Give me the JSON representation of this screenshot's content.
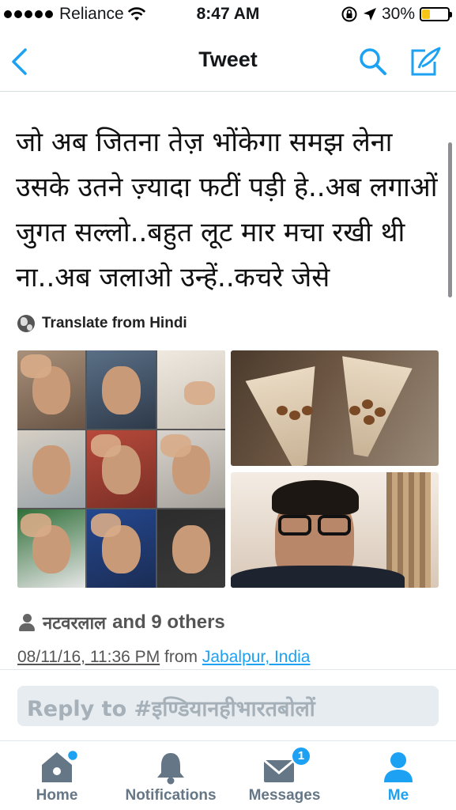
{
  "status_bar": {
    "carrier": "Reliance",
    "time": "8:47 AM",
    "battery_percent": "30%",
    "battery_level": 0.3,
    "battery_color": "#f5c518"
  },
  "nav": {
    "title": "Tweet",
    "back_icon": "chevron-left-icon",
    "search_icon": "search-icon",
    "compose_icon": "compose-icon",
    "accent": "#1da1f2"
  },
  "tweet": {
    "text": "जो अब जितना तेज़ भोंकेगा समझ लेना उसके उतने ज़्यादा फटीं पड़ी हे..अब लगाओं जुगत सल्लो..बहुत लूट मार मचा रखी थी ना..अब जलाओ उन्हें..कचरे जेसे",
    "translate_label": "Translate from Hindi",
    "likes_name": "नटवरलाल",
    "likes_rest": "and 9 others",
    "timestamp": "08/11/16, 11:36 PM",
    "from_label": "from",
    "location": "Jabalpur, India"
  },
  "reply": {
    "placeholder": "Reply to #इण्डियानहीभारतबोलों"
  },
  "tabs": [
    {
      "label": "Home",
      "icon": "home-icon",
      "active": false
    },
    {
      "label": "Notifications",
      "icon": "bell-icon",
      "active": false
    },
    {
      "label": "Messages",
      "icon": "envelope-icon",
      "active": false,
      "badge": "1"
    },
    {
      "label": "Me",
      "icon": "person-icon",
      "active": true
    }
  ]
}
